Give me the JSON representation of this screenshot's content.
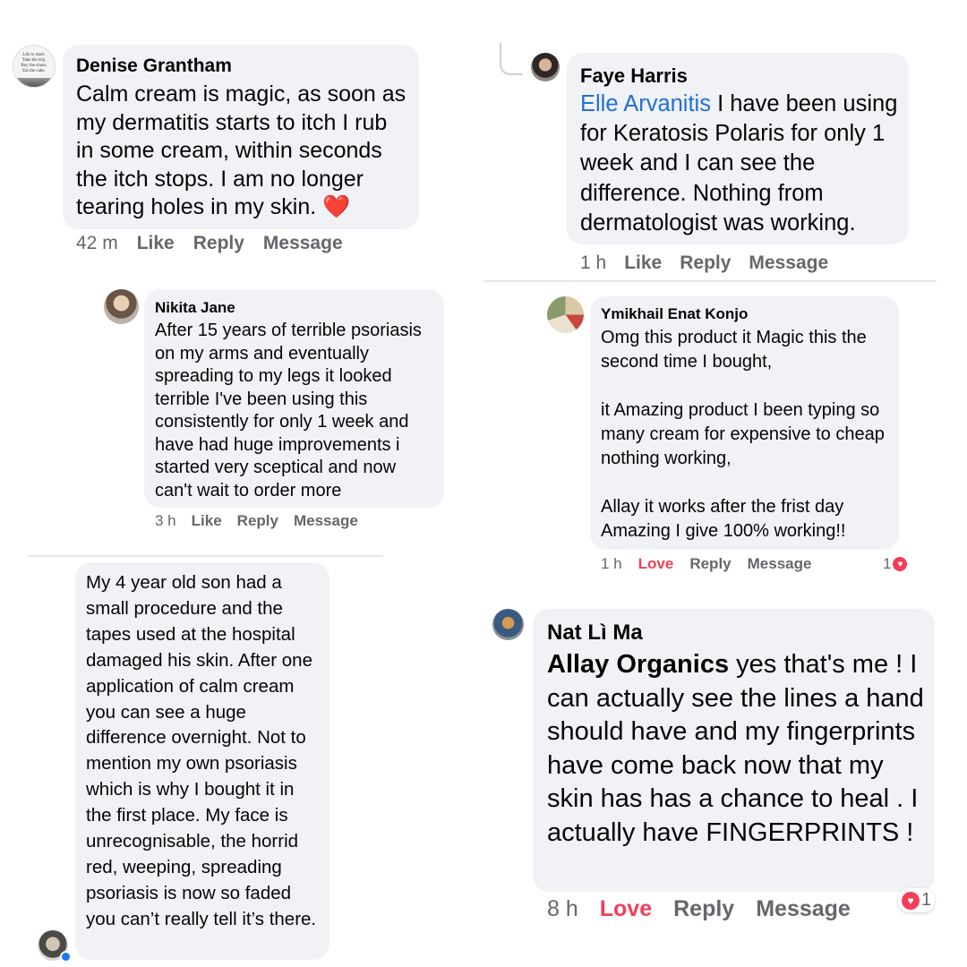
{
  "comments": [
    {
      "author": "Denise Grantham",
      "text": "Calm cream is magic, as soon as my dermatitis starts to itch I rub in some cream, within seconds the itch stops. I am no longer tearing holes in my skin. ",
      "emoji": "❤️",
      "avatar_lines": [
        "Life is short.",
        "Take the trip.",
        "Buy the shoes.",
        "Eat the cake."
      ],
      "time": "42 m",
      "like": "Like",
      "reply": "Reply",
      "message": "Message"
    },
    {
      "author": "Nikita Jane",
      "text": "After 15 years of terrible psoriasis on my arms and eventually spreading to my legs it looked terrible I've been using this consistently for only 1 week and have had huge improvements i started very sceptical and now can't wait to order more",
      "time": "3 h",
      "like": "Like",
      "reply": "Reply",
      "message": "Message"
    },
    {
      "author": "",
      "text": "My 4 year old son had a small procedure and the tapes used at the hospital damaged his skin. After one application of calm cream you can see a huge difference overnight. Not to mention my own psoriasis which is why I bought it in the first place. My face is unrecognisable, the horrid red, weeping, spreading psoriasis is now so faded you can’t really tell it’s there."
    },
    {
      "author": "Faye Harris",
      "mention": "Elle Arvanitis",
      "text": " I have been using for Keratosis Polaris for only 1 week and I can see the difference.  Nothing from dermatologist was working.",
      "time": "1 h",
      "like": "Like",
      "reply": "Reply",
      "message": "Message"
    },
    {
      "author": "Ymikhail Enat Konjo",
      "text": "Omg this product it Magic this the second time I bought,\n\nit Amazing product I been typing so many cream for expensive to cheap nothing working,\n\nAllay it works after the frist day Amazing I give 100% working!!",
      "time": "1 h",
      "love": "Love",
      "reply": "Reply",
      "message": "Message",
      "reaction_count": "1"
    },
    {
      "author": "Nat Lì Ma",
      "mention": "Allay Organics",
      "text": " yes that's me ! I can actually see the lines a hand should have and my fingerprints have come back now that my skin has has a chance to heal . I actually have FINGERPRINTS !",
      "time": "8 h",
      "love": "Love",
      "reply": "Reply",
      "message": "Message",
      "reaction_count": "1"
    }
  ],
  "colors": {
    "bubble": "#f0f2f5",
    "action_text": "#65676b",
    "mention": "#216fdb",
    "love": "#f33e58"
  },
  "icons": [
    "heart-icon",
    "messenger-badge-icon"
  ]
}
